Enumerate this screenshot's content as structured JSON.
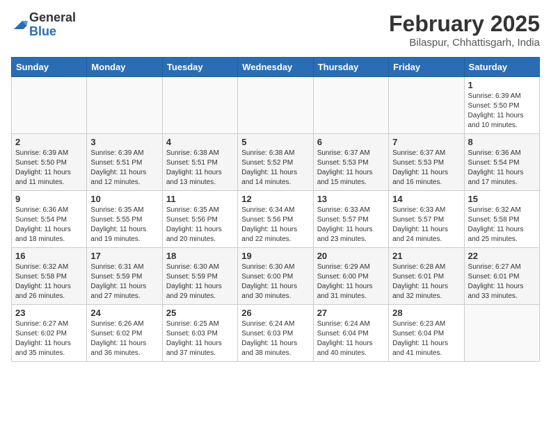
{
  "logo": {
    "general": "General",
    "blue": "Blue"
  },
  "header": {
    "month_year": "February 2025",
    "location": "Bilaspur, Chhattisgarh, India"
  },
  "weekdays": [
    "Sunday",
    "Monday",
    "Tuesday",
    "Wednesday",
    "Thursday",
    "Friday",
    "Saturday"
  ],
  "weeks": [
    [
      {
        "day": "",
        "info": ""
      },
      {
        "day": "",
        "info": ""
      },
      {
        "day": "",
        "info": ""
      },
      {
        "day": "",
        "info": ""
      },
      {
        "day": "",
        "info": ""
      },
      {
        "day": "",
        "info": ""
      },
      {
        "day": "1",
        "info": "Sunrise: 6:39 AM\nSunset: 5:50 PM\nDaylight: 11 hours\nand 10 minutes."
      }
    ],
    [
      {
        "day": "2",
        "info": "Sunrise: 6:39 AM\nSunset: 5:50 PM\nDaylight: 11 hours\nand 11 minutes."
      },
      {
        "day": "3",
        "info": "Sunrise: 6:39 AM\nSunset: 5:51 PM\nDaylight: 11 hours\nand 12 minutes."
      },
      {
        "day": "4",
        "info": "Sunrise: 6:38 AM\nSunset: 5:51 PM\nDaylight: 11 hours\nand 13 minutes."
      },
      {
        "day": "5",
        "info": "Sunrise: 6:38 AM\nSunset: 5:52 PM\nDaylight: 11 hours\nand 14 minutes."
      },
      {
        "day": "6",
        "info": "Sunrise: 6:37 AM\nSunset: 5:53 PM\nDaylight: 11 hours\nand 15 minutes."
      },
      {
        "day": "7",
        "info": "Sunrise: 6:37 AM\nSunset: 5:53 PM\nDaylight: 11 hours\nand 16 minutes."
      },
      {
        "day": "8",
        "info": "Sunrise: 6:36 AM\nSunset: 5:54 PM\nDaylight: 11 hours\nand 17 minutes."
      }
    ],
    [
      {
        "day": "9",
        "info": "Sunrise: 6:36 AM\nSunset: 5:54 PM\nDaylight: 11 hours\nand 18 minutes."
      },
      {
        "day": "10",
        "info": "Sunrise: 6:35 AM\nSunset: 5:55 PM\nDaylight: 11 hours\nand 19 minutes."
      },
      {
        "day": "11",
        "info": "Sunrise: 6:35 AM\nSunset: 5:56 PM\nDaylight: 11 hours\nand 20 minutes."
      },
      {
        "day": "12",
        "info": "Sunrise: 6:34 AM\nSunset: 5:56 PM\nDaylight: 11 hours\nand 22 minutes."
      },
      {
        "day": "13",
        "info": "Sunrise: 6:33 AM\nSunset: 5:57 PM\nDaylight: 11 hours\nand 23 minutes."
      },
      {
        "day": "14",
        "info": "Sunrise: 6:33 AM\nSunset: 5:57 PM\nDaylight: 11 hours\nand 24 minutes."
      },
      {
        "day": "15",
        "info": "Sunrise: 6:32 AM\nSunset: 5:58 PM\nDaylight: 11 hours\nand 25 minutes."
      }
    ],
    [
      {
        "day": "16",
        "info": "Sunrise: 6:32 AM\nSunset: 5:58 PM\nDaylight: 11 hours\nand 26 minutes."
      },
      {
        "day": "17",
        "info": "Sunrise: 6:31 AM\nSunset: 5:59 PM\nDaylight: 11 hours\nand 27 minutes."
      },
      {
        "day": "18",
        "info": "Sunrise: 6:30 AM\nSunset: 5:59 PM\nDaylight: 11 hours\nand 29 minutes."
      },
      {
        "day": "19",
        "info": "Sunrise: 6:30 AM\nSunset: 6:00 PM\nDaylight: 11 hours\nand 30 minutes."
      },
      {
        "day": "20",
        "info": "Sunrise: 6:29 AM\nSunset: 6:00 PM\nDaylight: 11 hours\nand 31 minutes."
      },
      {
        "day": "21",
        "info": "Sunrise: 6:28 AM\nSunset: 6:01 PM\nDaylight: 11 hours\nand 32 minutes."
      },
      {
        "day": "22",
        "info": "Sunrise: 6:27 AM\nSunset: 6:01 PM\nDaylight: 11 hours\nand 33 minutes."
      }
    ],
    [
      {
        "day": "23",
        "info": "Sunrise: 6:27 AM\nSunset: 6:02 PM\nDaylight: 11 hours\nand 35 minutes."
      },
      {
        "day": "24",
        "info": "Sunrise: 6:26 AM\nSunset: 6:02 PM\nDaylight: 11 hours\nand 36 minutes."
      },
      {
        "day": "25",
        "info": "Sunrise: 6:25 AM\nSunset: 6:03 PM\nDaylight: 11 hours\nand 37 minutes."
      },
      {
        "day": "26",
        "info": "Sunrise: 6:24 AM\nSunset: 6:03 PM\nDaylight: 11 hours\nand 38 minutes."
      },
      {
        "day": "27",
        "info": "Sunrise: 6:24 AM\nSunset: 6:04 PM\nDaylight: 11 hours\nand 40 minutes."
      },
      {
        "day": "28",
        "info": "Sunrise: 6:23 AM\nSunset: 6:04 PM\nDaylight: 11 hours\nand 41 minutes."
      },
      {
        "day": "",
        "info": ""
      }
    ]
  ]
}
